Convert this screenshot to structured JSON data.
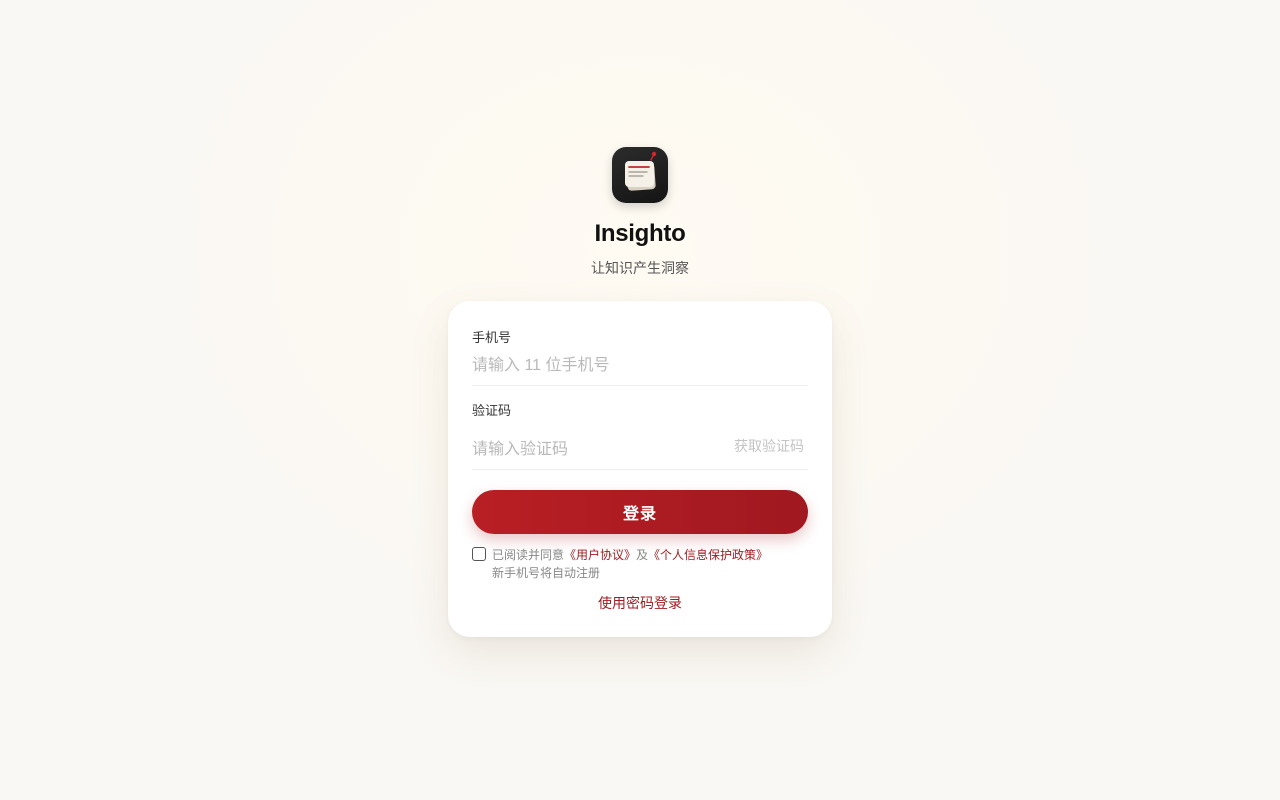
{
  "brand": {
    "name": "Insighto",
    "slogan": "让知识产生洞察",
    "logo_icon": "notes-icon"
  },
  "form": {
    "phone": {
      "label": "手机号",
      "placeholder": "请输入 11 位手机号",
      "value": ""
    },
    "code": {
      "label": "验证码",
      "placeholder": "请输入验证码",
      "value": "",
      "get_code_label": "获取验证码"
    },
    "login_label": "登录",
    "agreement": {
      "checked": false,
      "prefix": "已阅读并同意",
      "user_agreement": "《用户协议》",
      "conjunction": "及",
      "privacy_policy": "《个人信息保护政策》",
      "auto_register_note": "新手机号将自动注册"
    },
    "password_login_label": "使用密码登录"
  },
  "colors": {
    "accent": "#a11d22",
    "button_start": "#b91f24",
    "button_end": "#a01820",
    "background": "#fcf9f2"
  }
}
